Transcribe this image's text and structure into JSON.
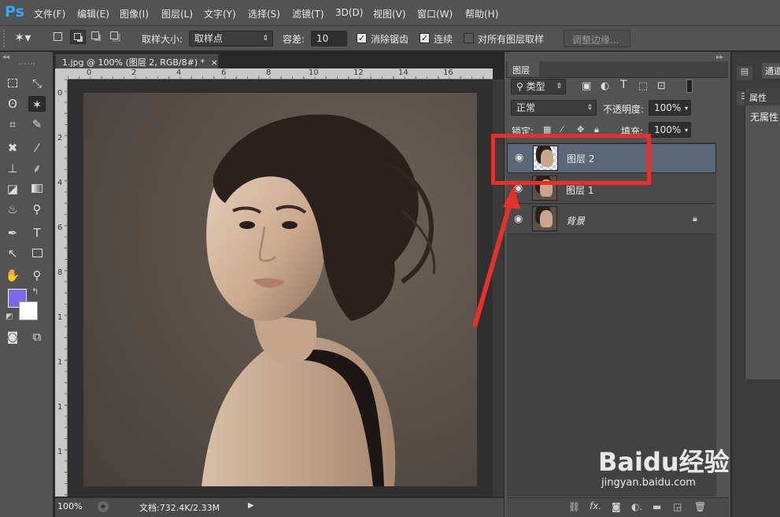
{
  "app": {
    "logo": "Ps"
  },
  "menu": [
    "文件(F)",
    "编辑(E)",
    "图像(I)",
    "图层(L)",
    "文字(Y)",
    "选择(S)",
    "滤镜(T)",
    "3D(D)",
    "视图(V)",
    "窗口(W)",
    "帮助(H)"
  ],
  "options": {
    "sample_size_label": "取样大小:",
    "sample_size_value": "取样点",
    "tolerance_label": "容差:",
    "tolerance_value": "10",
    "antialias_label": "消除锯齿",
    "antialias_checked": true,
    "contiguous_label": "连续",
    "contiguous_checked": true,
    "all_layers_label": "对所有图层取样",
    "all_layers_checked": false,
    "refine_edge_label": "调整边缘..."
  },
  "document": {
    "tab_title": "1.jpg @ 100% (图层 2, RGB/8#) *",
    "close": "×",
    "ruler_top": [
      "0",
      "2",
      "4",
      "6",
      "8",
      "10",
      "12",
      "14",
      "16"
    ],
    "ruler_left": [
      "0",
      "2",
      "4",
      "6",
      "8",
      "1",
      "1",
      "1",
      "1"
    ],
    "zoom": "100%",
    "doc_info": "文档:732.4K/2.33M"
  },
  "layers_panel": {
    "tab": "图层",
    "filter": "类型",
    "blend_mode": "正常",
    "opacity_label": "不透明度:",
    "opacity_value": "100%",
    "lock_label": "锁定:",
    "fill_label": "填充:",
    "fill_value": "100%",
    "layers": [
      {
        "name": "图层 2",
        "selected": true,
        "locked": false
      },
      {
        "name": "图层 1",
        "selected": false,
        "locked": false
      },
      {
        "name": "背景",
        "selected": false,
        "locked": true
      }
    ]
  },
  "right_dock": {
    "channels_tab": "通道",
    "properties_tab": "属性",
    "no_properties": "无属性"
  },
  "watermark": {
    "text": "Baidu经验",
    "url": "jingyan.baidu.com"
  },
  "colors": {
    "foreground": "#7b68e8",
    "background": "#ffffff",
    "highlight": "#e8302b"
  }
}
